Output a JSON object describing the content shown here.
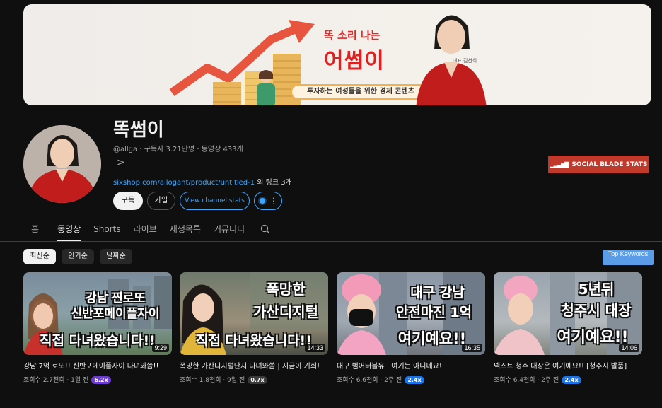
{
  "banner": {
    "tagline": "똑 소리 나는",
    "brand": "어썸이",
    "pill": "투자하는 여성들을 위한 경제 콘텐츠",
    "caption": "대표 김선희"
  },
  "channel": {
    "name": "똑썸이",
    "handle": "@allga",
    "meta": "@allga · 구독자 3.21만명 · 동영상 433개",
    "more": ">",
    "link": "sixshop.com/allogant/product/untitled-1",
    "link_extra": " 외 링크 3개"
  },
  "buttons": {
    "subscribe": "구독",
    "join": "가입",
    "channel_stats": "View channel stats",
    "ext_more": "⋮",
    "social_blade": "SOCIAL BLADE STATS"
  },
  "tabs": [
    "홈",
    "동영상",
    "Shorts",
    "라이브",
    "재생목록",
    "커뮤니티"
  ],
  "chips": [
    "최신순",
    "인기순",
    "날짜순"
  ],
  "top_keywords": "Top Keywords",
  "videos": [
    {
      "line1": "강남 찐로또",
      "line2": "신반포메이플자이",
      "line3": "직접 다녀왔습니다!!",
      "duration": "9:29",
      "title": "강남 7억 로또!! 신반포메이플자이 다녀와씀!!",
      "meta": "조회수 2.7천회 · 1일 전",
      "badge": "6.2x",
      "badge_color": "#6d3bd4"
    },
    {
      "line1": "폭망한",
      "line2": "가산디지털",
      "line3": "직접 다녀왔습니다!!",
      "duration": "14:33",
      "title": "폭망한 가산디지털단지 다녀와씀 | 지금이 기회!",
      "meta": "조회수 1.8천회 · 9일 전",
      "badge": "0.7x",
      "badge_color": "#3a3a3a"
    },
    {
      "line1": "대구 강남",
      "line2": "안전마진 1억",
      "line3": "여기예요!!",
      "duration": "16:35",
      "title": "대구 범어터블유 | 여기는 아니네요!",
      "meta": "조회수 6.6천회 · 2주 전",
      "badge": "2.4x",
      "badge_color": "#1a73e8"
    },
    {
      "line1": "5년뒤",
      "line2": "청주시 대장",
      "line3": "여기예요!!",
      "duration": "14:06",
      "title": "넥스트 청주 대장은 여기예요!! [청주시 발품]",
      "meta": "조회수 6.4천회 · 2주 전",
      "badge": "2.4x",
      "badge_color": "#1a73e8"
    }
  ],
  "colors": {
    "background": "#0f0f0f",
    "link": "#3ea6ff",
    "social_blade": "#c0392b",
    "brand_red": "#e02020"
  }
}
